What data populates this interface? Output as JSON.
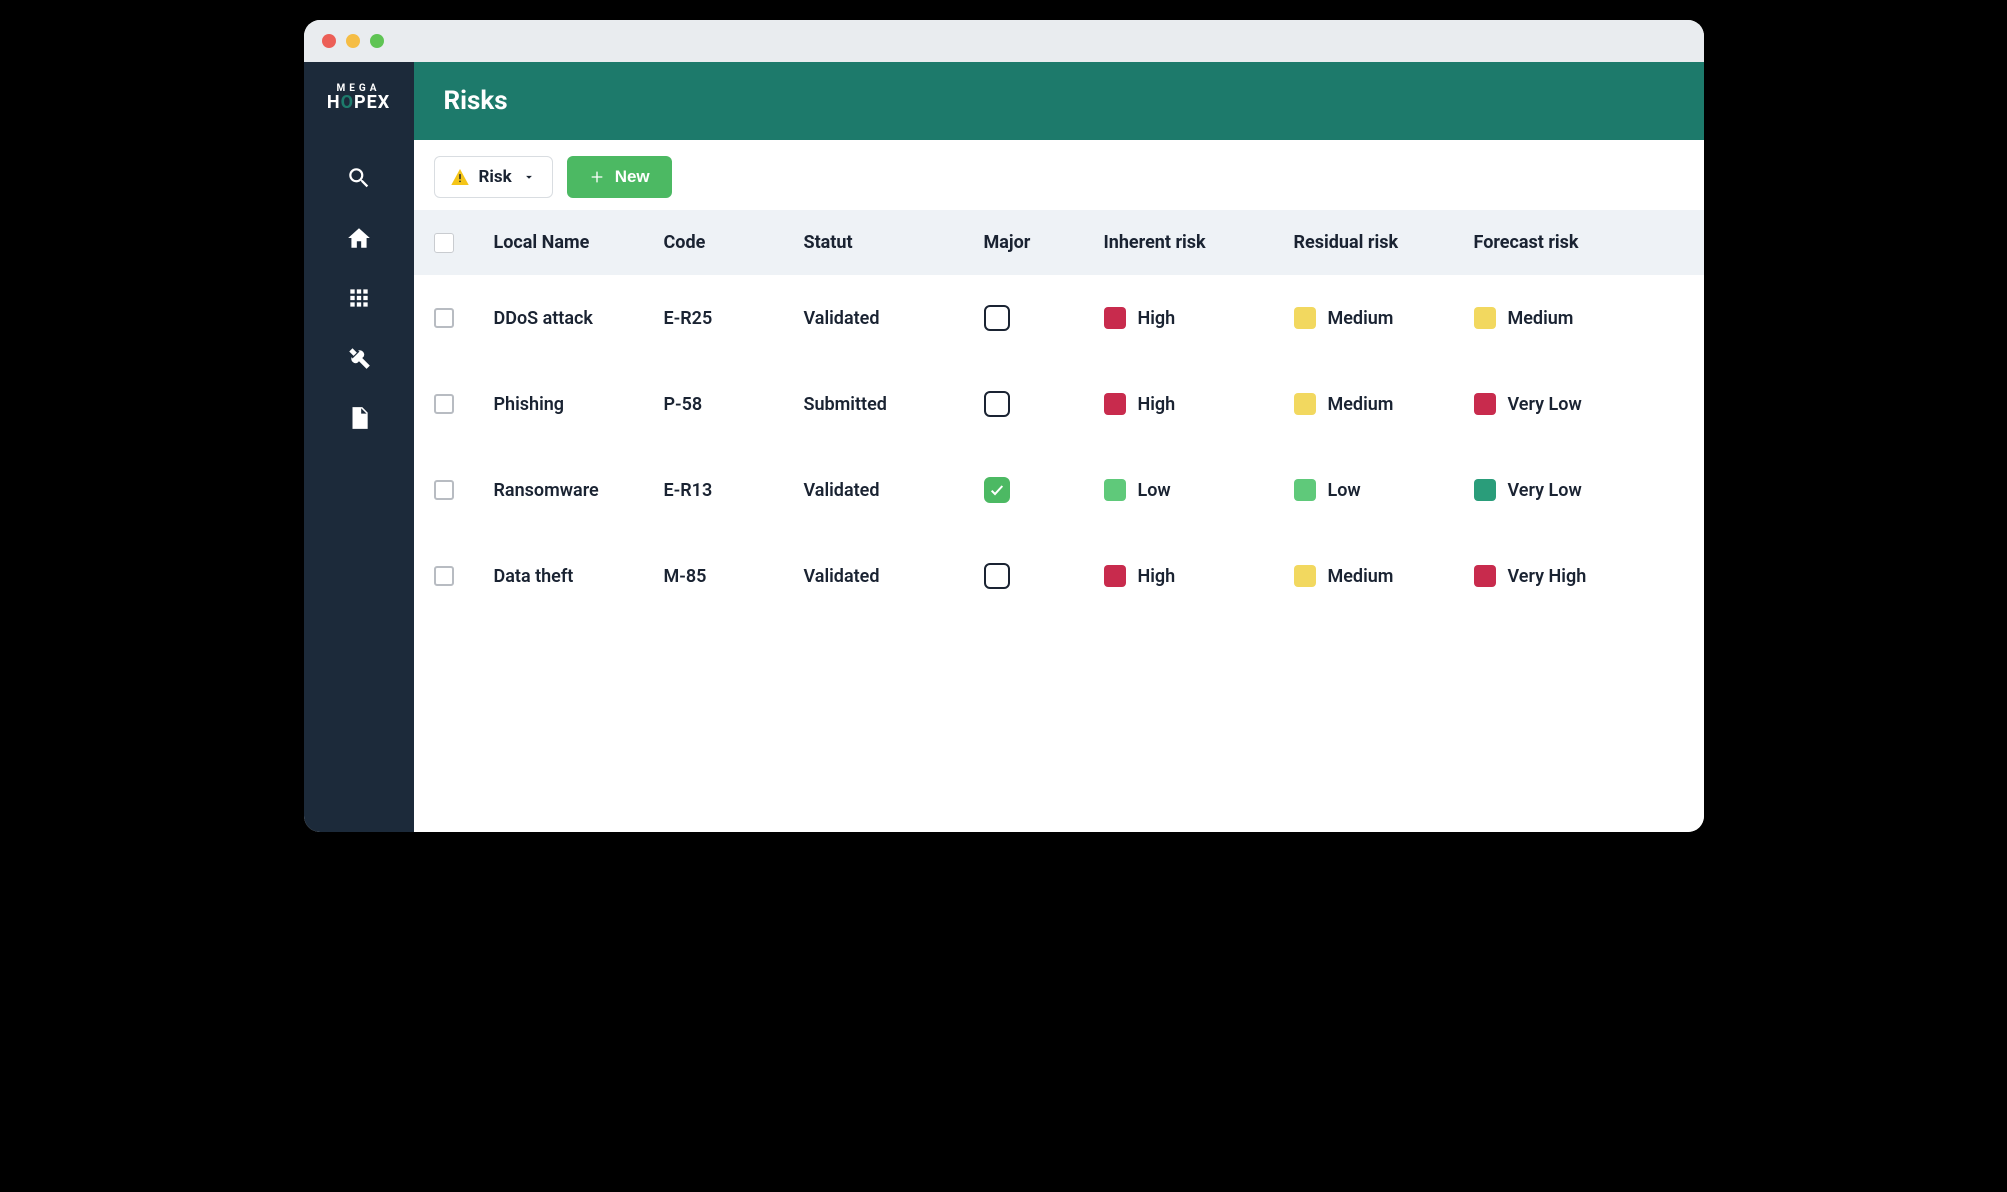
{
  "logo": {
    "line1": "MEGA",
    "line2_pre": "H",
    "line2_o": "O",
    "line2_post": "PEX"
  },
  "header": {
    "title": "Risks"
  },
  "toolbar": {
    "filter_label": "Risk",
    "new_label": "New"
  },
  "columns": {
    "local_name": "Local Name",
    "code": "Code",
    "statut": "Statut",
    "major": "Major",
    "inherent": "Inherent risk",
    "residual": "Residual risk",
    "forecast": "Forecast risk"
  },
  "rows": [
    {
      "name": "DDoS attack",
      "code": "E-R25",
      "statut": "Validated",
      "major": false,
      "inherent": {
        "label": "High",
        "color": "sw-red"
      },
      "residual": {
        "label": "Medium",
        "color": "sw-yellow"
      },
      "forecast": {
        "label": "Medium",
        "color": "sw-yellow"
      }
    },
    {
      "name": "Phishing",
      "code": "P-58",
      "statut": "Submitted",
      "major": false,
      "inherent": {
        "label": "High",
        "color": "sw-red"
      },
      "residual": {
        "label": "Medium",
        "color": "sw-yellow"
      },
      "forecast": {
        "label": "Very Low",
        "color": "sw-red"
      }
    },
    {
      "name": "Ransomware",
      "code": "E-R13",
      "statut": "Validated",
      "major": true,
      "inherent": {
        "label": "Low",
        "color": "sw-lightgreen"
      },
      "residual": {
        "label": "Low",
        "color": "sw-lightgreen"
      },
      "forecast": {
        "label": "Very Low",
        "color": "sw-teal"
      }
    },
    {
      "name": "Data theft",
      "code": "M-85",
      "statut": "Validated",
      "major": false,
      "inherent": {
        "label": "High",
        "color": "sw-red"
      },
      "residual": {
        "label": "Medium",
        "color": "sw-yellow"
      },
      "forecast": {
        "label": "Very High",
        "color": "sw-red"
      }
    }
  ]
}
